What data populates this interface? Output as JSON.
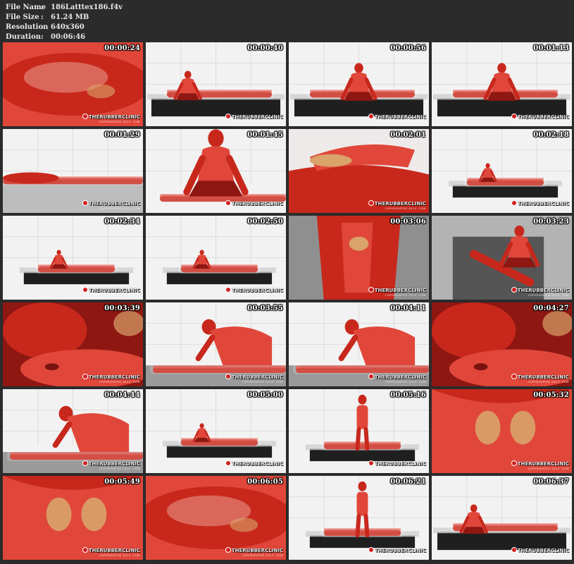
{
  "file_info": {
    "rows": [
      {
        "label": "File Name",
        "sep": ":",
        "value": "186Latttex186.f4v"
      },
      {
        "label": "File Size",
        "sep": ":",
        "value": "61.24 MB"
      },
      {
        "label": "Resolution",
        "sep": ":",
        "value": "640x360"
      },
      {
        "label": "Duration",
        "sep": ":",
        "value": "00:06:46"
      }
    ]
  },
  "watermark": {
    "brand": "THERUBBERCLINIC",
    "copyright": "COPYRIGHTED 2013 .COM"
  },
  "thumbnails": [
    {
      "timestamp": "00:00:24",
      "scene": "closeup"
    },
    {
      "timestamp": "00:00:40",
      "scene": "wide-kneel"
    },
    {
      "timestamp": "00:00:56",
      "scene": "wide-upright"
    },
    {
      "timestamp": "00:01:13",
      "scene": "wide-upright"
    },
    {
      "timestamp": "00:01:29",
      "scene": "bag-side"
    },
    {
      "timestamp": "00:01:45",
      "scene": "kneel-close"
    },
    {
      "timestamp": "00:02:01",
      "scene": "hands-close"
    },
    {
      "timestamp": "00:02:18",
      "scene": "wide-small"
    },
    {
      "timestamp": "00:02:34",
      "scene": "wide-small"
    },
    {
      "timestamp": "00:02:50",
      "scene": "wide-small"
    },
    {
      "timestamp": "00:03:06",
      "scene": "overhead"
    },
    {
      "timestamp": "00:03:23",
      "scene": "overhead-kneel"
    },
    {
      "timestamp": "00:03:39",
      "scene": "face-close"
    },
    {
      "timestamp": "00:03:55",
      "scene": "lean-over"
    },
    {
      "timestamp": "00:04:11",
      "scene": "lean-over"
    },
    {
      "timestamp": "00:04:27",
      "scene": "face-close"
    },
    {
      "timestamp": "00:04:44",
      "scene": "lean-over"
    },
    {
      "timestamp": "00:05:00",
      "scene": "wide-small"
    },
    {
      "timestamp": "00:05:16",
      "scene": "wide-standing"
    },
    {
      "timestamp": "00:05:32",
      "scene": "body-close"
    },
    {
      "timestamp": "00:05:49",
      "scene": "body-close"
    },
    {
      "timestamp": "00:06:05",
      "scene": "closeup"
    },
    {
      "timestamp": "00:06:21",
      "scene": "wide-standing"
    },
    {
      "timestamp": "00:06:37",
      "scene": "wide-kneel"
    }
  ]
}
